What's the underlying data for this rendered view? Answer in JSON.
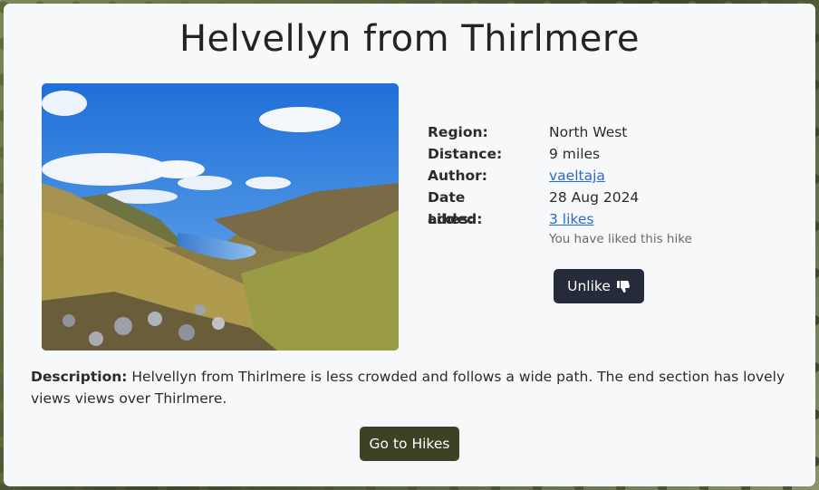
{
  "hike": {
    "title": "Helvellyn from Thirlmere",
    "photo_icon": "landscape-photo"
  },
  "details": {
    "region_label": "Region:",
    "region_value": "North West",
    "distance_label": "Distance:",
    "distance_value": "9 miles",
    "author_label": "Author:",
    "author_value": "vaeltaja",
    "date_label": "Date added:",
    "date_value": "28 Aug 2024",
    "likes_label": "Likes:",
    "likes_value": "3 likes",
    "liked_note": "You have liked this hike"
  },
  "actions": {
    "unlike_label": "Unlike",
    "unlike_icon": "thumbs-down-icon",
    "go_label": "Go to Hikes"
  },
  "description": {
    "label": "Description:",
    "text": " Helvellyn from Thirlmere is less crowded and follows a wide path. The end section has lovely views views over Thirlmere."
  },
  "colors": {
    "unlike_button": "#252b3a",
    "go_button": "#3b4324",
    "link": "#2a6cc9"
  }
}
